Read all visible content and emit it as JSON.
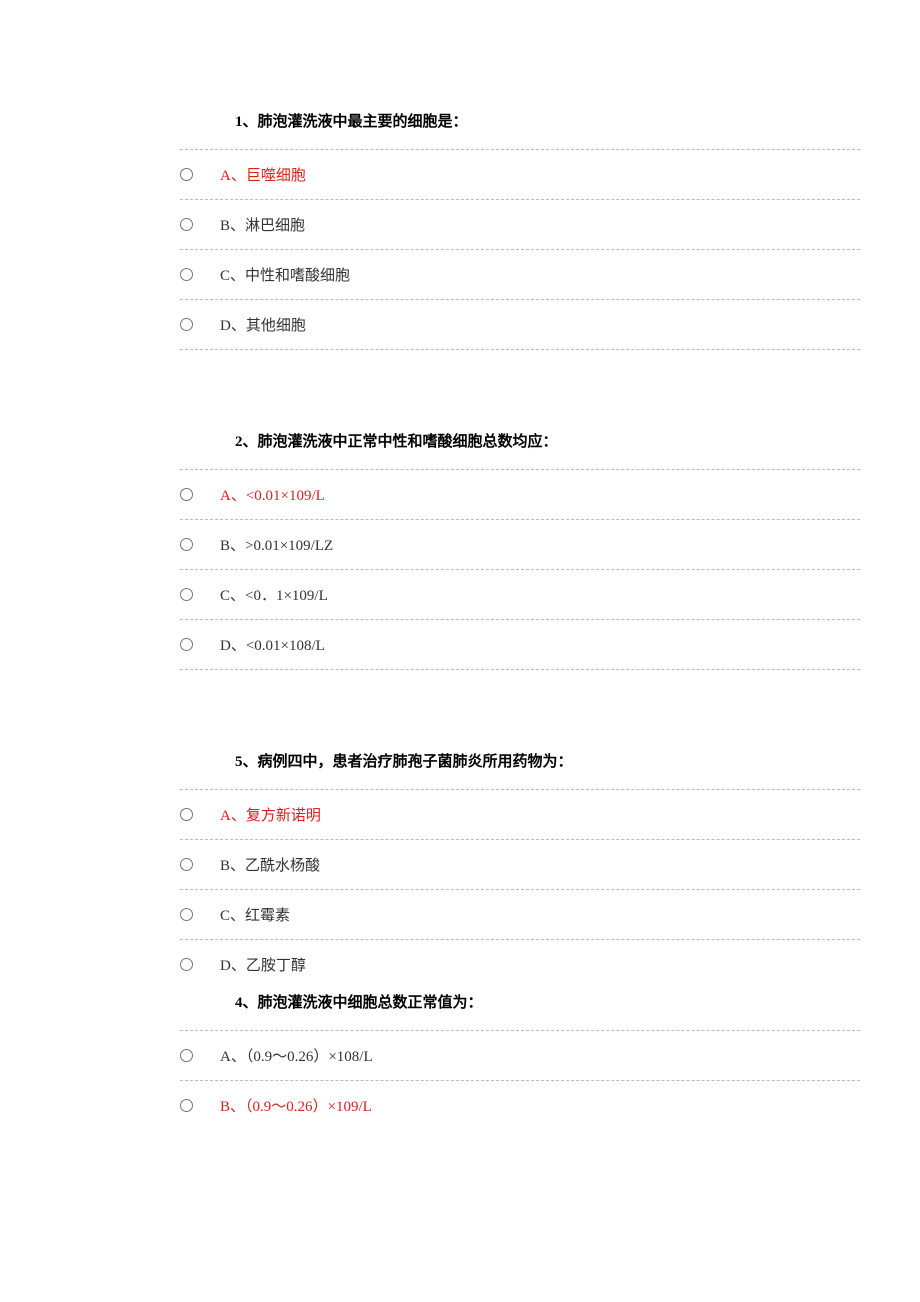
{
  "questions": [
    {
      "stem": "1、肺泡灌洗液中最主要的细胞是：",
      "options": [
        {
          "text": "A、巨噬细胞",
          "correct": true
        },
        {
          "text": "B、淋巴细胞",
          "correct": false
        },
        {
          "text": "C、中性和嗜酸细胞",
          "correct": false
        },
        {
          "text": "D、其他细胞",
          "correct": false
        }
      ]
    },
    {
      "stem": "2、肺泡灌洗液中正常中性和嗜酸细胞总数均应：",
      "options": [
        {
          "text": "A、<0.01×109/L",
          "correct": true
        },
        {
          "text": "B、>0.01×109/LZ",
          "correct": false
        },
        {
          "text": "C、<0．1×109/L",
          "correct": false
        },
        {
          "text": "D、<0.01×108/L",
          "correct": false
        }
      ]
    },
    {
      "stem": "5、病例四中，患者治疗肺孢子菌肺炎所用药物为：",
      "options": [
        {
          "text": "A、复方新诺明",
          "correct": true
        },
        {
          "text": "B、乙酰水杨酸",
          "correct": false
        },
        {
          "text": "C、红霉素",
          "correct": false
        },
        {
          "text": "D、乙胺丁醇",
          "correct": false
        }
      ]
    },
    {
      "stem": "4、肺泡灌洗液中细胞总数正常值为：",
      "options": [
        {
          "text": "A、（0.9～0.26）×108/L",
          "correct": false
        },
        {
          "text": "B、（0.9～0.26）×109/L",
          "correct": true
        }
      ]
    }
  ]
}
